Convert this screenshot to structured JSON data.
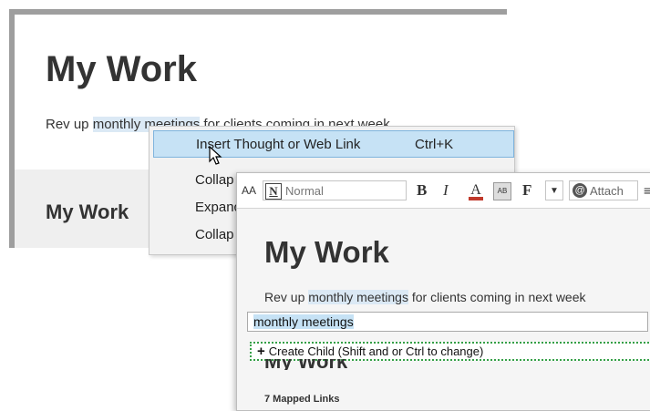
{
  "back_window": {
    "title": "My Work",
    "description_before": "Rev up ",
    "description_link": "monthly meetings",
    "description_after": " for clients coming in next week",
    "lower_title": "My Work"
  },
  "context_menu": {
    "items": [
      {
        "label": "Insert Thought or Web Link",
        "shortcut": "Ctrl+K",
        "selected": true
      },
      {
        "label": "Collap"
      },
      {
        "label": "Expanc"
      },
      {
        "label": "Collap"
      }
    ]
  },
  "front_window": {
    "toolbar": {
      "font_size_label": "AA",
      "style_icon": "N",
      "style_value": "Normal",
      "bold": "B",
      "italic": "I",
      "font_color": "A",
      "highlight": "AB",
      "format": "F",
      "attach_label": "Attach",
      "more": "≡"
    },
    "title": "My Work",
    "description_before": "Rev up ",
    "description_link": "monthly meetings",
    "description_after": " for clients coming in next week",
    "search_value": "monthly meetings",
    "suggestion": "Create Child (Shift and or Ctrl to change)",
    "peek_title": "My Work",
    "links_count": "7 Mapped Links"
  }
}
